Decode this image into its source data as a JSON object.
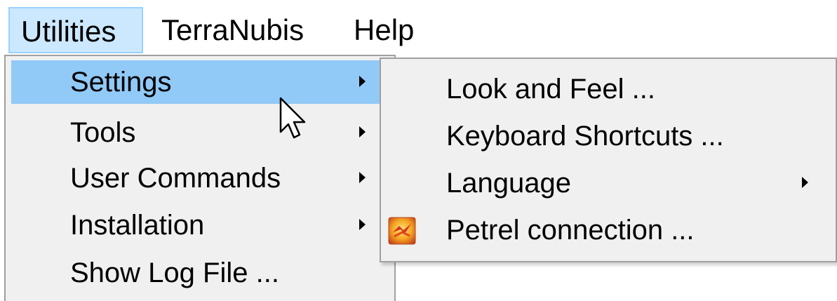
{
  "menubar": {
    "items": [
      {
        "label": "Utilities"
      },
      {
        "label": "TerraNubis"
      },
      {
        "label": "Help"
      }
    ]
  },
  "dropdown": {
    "items": [
      {
        "label": "Settings",
        "has_submenu": true,
        "highlighted": true
      },
      {
        "label": "Tools",
        "has_submenu": true
      },
      {
        "label": "User Commands",
        "has_submenu": true
      },
      {
        "label": "Installation",
        "has_submenu": true
      },
      {
        "label": "Show Log File ...",
        "has_submenu": false
      }
    ]
  },
  "submenu": {
    "items": [
      {
        "label": "Look and Feel ...",
        "has_submenu": false
      },
      {
        "label": "Keyboard Shortcuts ...",
        "has_submenu": false
      },
      {
        "label": "Language",
        "has_submenu": true
      },
      {
        "label": "Petrel connection ...",
        "has_submenu": false,
        "icon": "petrel-icon"
      }
    ]
  },
  "colors": {
    "menubar_active_bg": "#cce8ff",
    "menu_highlight": "#91c9f7",
    "menu_bg": "#f0f0f0"
  }
}
